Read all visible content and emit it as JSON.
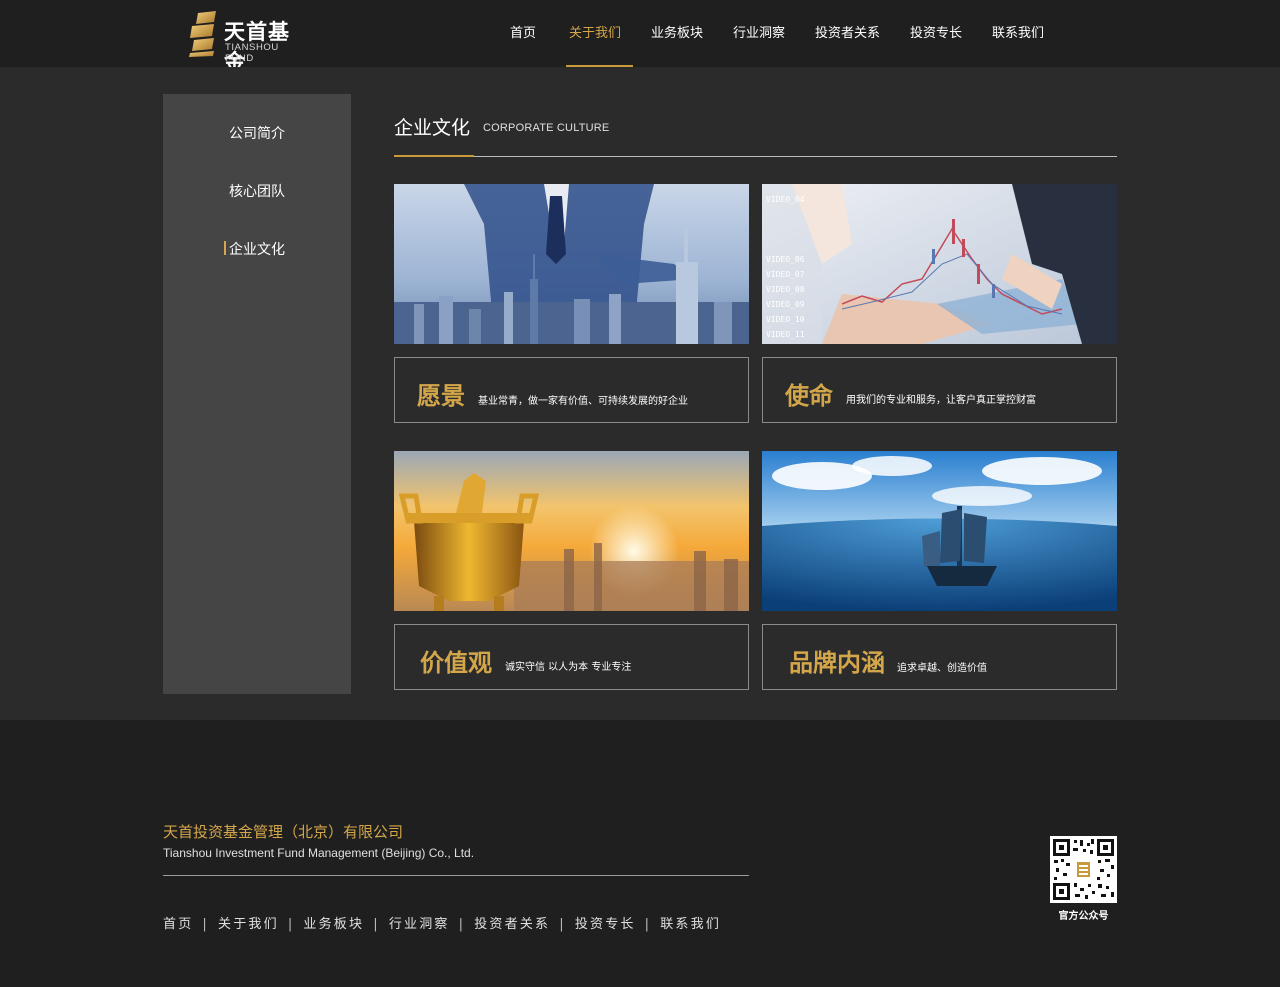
{
  "brand": {
    "name_cn": "天首基金",
    "name_en": "TIANSHOU FUND",
    "gold": "#d4a64a",
    "header_bg": "#1f1f1f",
    "main_bg": "#2b2b2b",
    "sidebar_bg": "#454545"
  },
  "nav": {
    "items": [
      {
        "label": "首页",
        "active": false
      },
      {
        "label": "关于我们",
        "active": true
      },
      {
        "label": "业务板块",
        "active": false
      },
      {
        "label": "行业洞察",
        "active": false
      },
      {
        "label": "投资者关系",
        "active": false
      },
      {
        "label": "投资专长",
        "active": false
      },
      {
        "label": "联系我们",
        "active": false
      }
    ]
  },
  "sidebar": {
    "items": [
      {
        "label": "公司简介",
        "active": false
      },
      {
        "label": "核心团队",
        "active": false
      },
      {
        "label": "企业文化",
        "active": true
      }
    ]
  },
  "section": {
    "title": "企业文化",
    "subtitle": "CORPORATE CULTURE"
  },
  "cards": [
    {
      "heading": "愿景",
      "text": "基业常青，做一家有价值、可持续发展的好企业",
      "image": "business-city-image"
    },
    {
      "heading": "使命",
      "text": "用我们的专业和服务，让客户真正掌控财富",
      "image": "financial-chart-image"
    },
    {
      "heading": "价值观",
      "text": "诚实守信  以人为本  专业专注",
      "image": "golden-cauldron-image"
    },
    {
      "heading": "品牌内涵",
      "text": "追求卓越、创造价值",
      "image": "sailing-ship-image"
    }
  ],
  "footer": {
    "company_cn": "天首投资基金管理（北京）有限公司",
    "company_en": "Tianshou Investment Fund Management (Beijing) Co., Ltd.",
    "links": [
      "首页",
      "关于我们",
      "业务板块",
      "行业洞察",
      "投资者关系",
      "投资专长",
      "联系我们"
    ],
    "separator": "|",
    "qr_label": "官方公众号"
  }
}
